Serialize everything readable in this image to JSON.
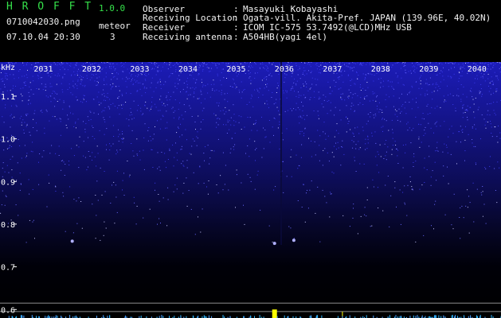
{
  "header": {
    "app_name": "H R O F F T",
    "version": "1.0.0",
    "filename": "0710042030.png",
    "datetime": "07.10.04 20:30",
    "meteor_label": "meteor",
    "meteor_count": "3",
    "info": [
      {
        "label": "Observer",
        "sep": ":",
        "value": "Masayuki Kobayashi"
      },
      {
        "label": "Receiving Location",
        "sep": ":",
        "value": "Ogata-vill. Akita-Pref. JAPAN (139.96E, 40.02N)"
      },
      {
        "label": "Receiver",
        "sep": ":",
        "value": "ICOM IC-575 53.7492(@LCD)MHz USB"
      },
      {
        "label": "Receiving antenna",
        "sep": ":",
        "value": "A504HB(yagi 4el)"
      }
    ]
  },
  "colors": {
    "text_green": "#35e04a",
    "text_white": "#f2f2f2",
    "background": "#000000",
    "noise_blue": "#3a3aff",
    "guide_line": "#8c8c8c",
    "meteor_echo": "#ffff00"
  },
  "chart_data": {
    "type": "heatmap",
    "ylabel": "kHz",
    "y_ticks": [
      "1.1",
      "1.0",
      "0.9",
      "0.8",
      "0.7",
      "0.6"
    ],
    "y_tick_values": [
      1.1,
      1.0,
      0.9,
      0.8,
      0.7,
      0.6
    ],
    "ylim": [
      0.58,
      1.18
    ],
    "time_labels": [
      "2031",
      "2032",
      "2033",
      "2034",
      "2035",
      "2036",
      "2037",
      "2038",
      "2039",
      "2040"
    ],
    "time_values": [
      2031,
      2032,
      2033,
      2034,
      2035,
      2036,
      2037,
      2038,
      2039,
      2040
    ],
    "xlim": [
      2030.1,
      2040.5
    ],
    "meteor_echoes": [
      {
        "time": 2035.8,
        "freq": 0.755
      },
      {
        "time": 2031.6,
        "freq": 0.76
      },
      {
        "time": 2036.2,
        "freq": 0.762
      }
    ],
    "guide_lines_khz": [
      0.615,
      0.595
    ]
  }
}
